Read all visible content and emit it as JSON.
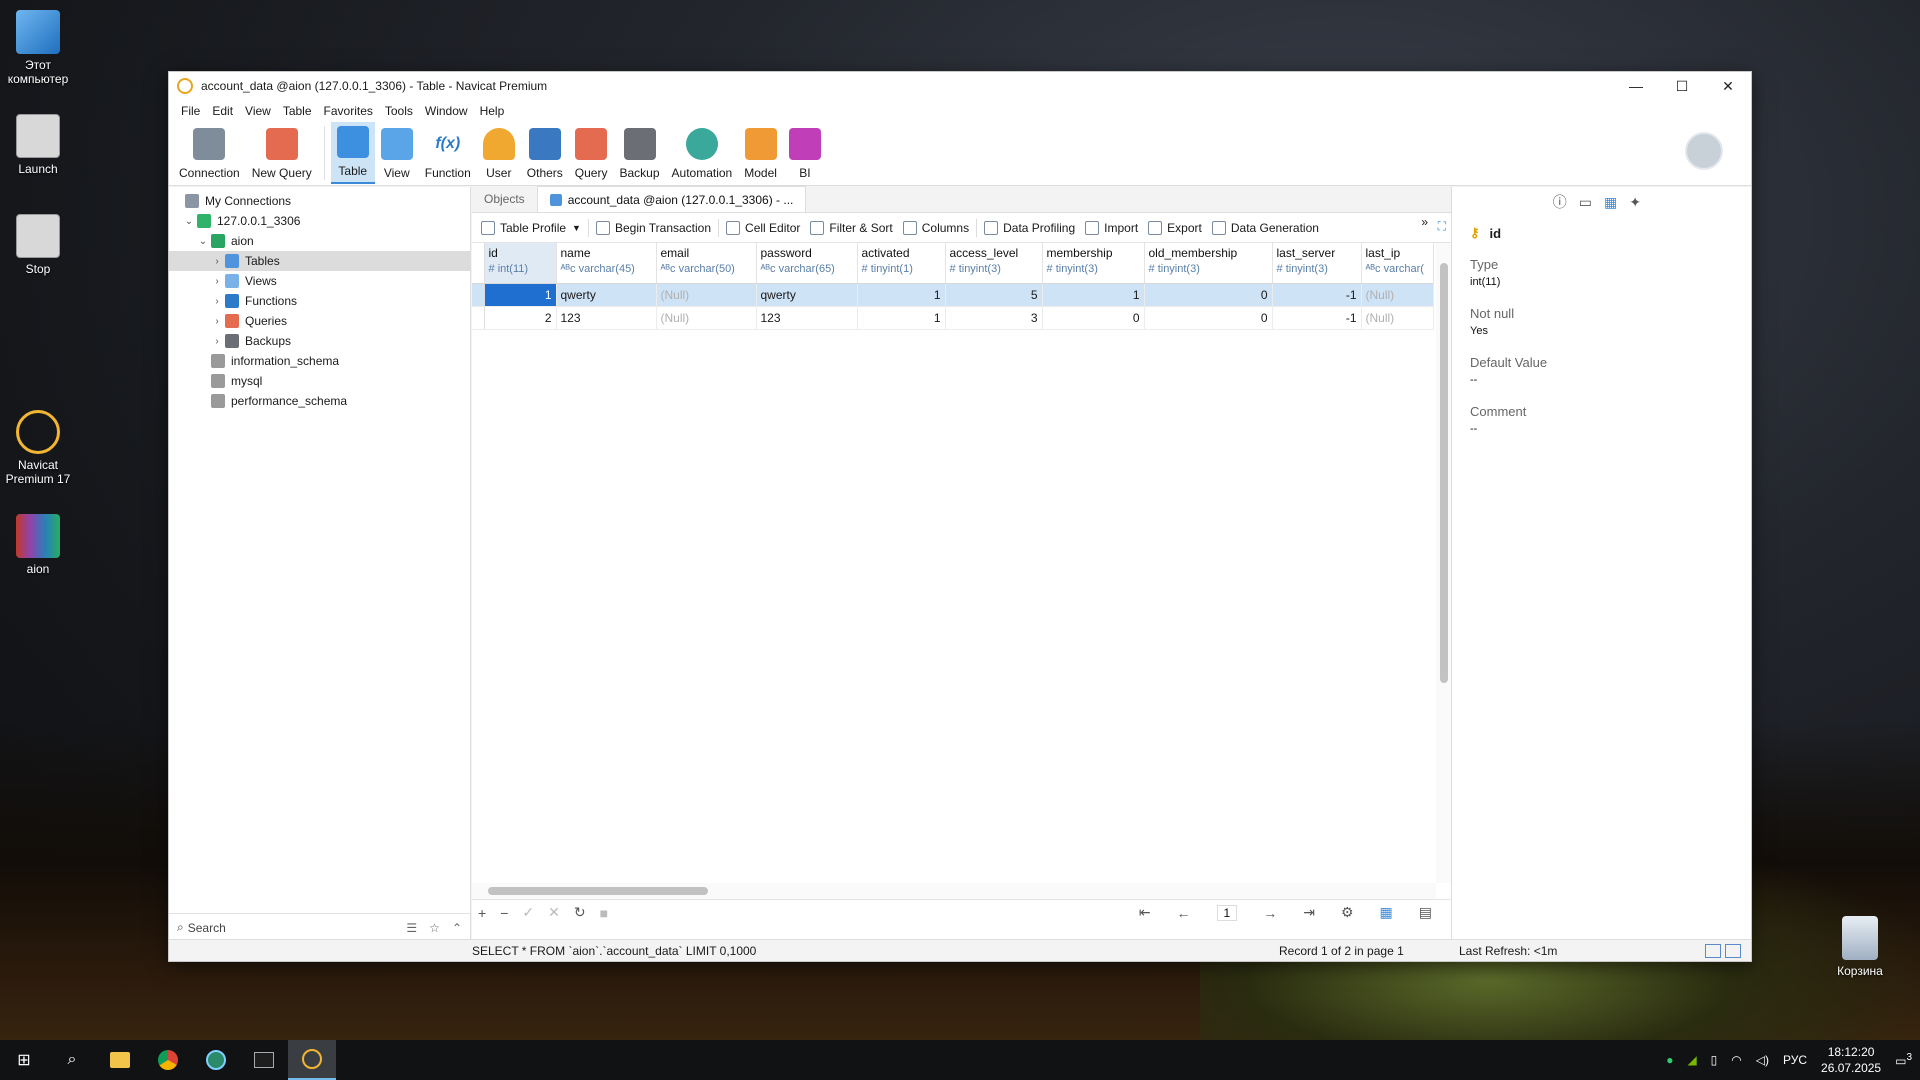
{
  "desktop": {
    "icons": [
      {
        "label": "Этот компьютер",
        "icon": "computer-icon"
      },
      {
        "label": "Launch",
        "icon": "gear-shortcut-icon"
      },
      {
        "label": "Stop",
        "icon": "gear-shortcut-icon"
      },
      {
        "label": "Navicat Premium 17",
        "icon": "navicat-icon"
      },
      {
        "label": "aion",
        "icon": "archive-icon"
      }
    ],
    "recycle_bin": "Корзина"
  },
  "window": {
    "title": "account_data @aion (127.0.0.1_3306) - Table - Navicat Premium",
    "controls": {
      "minimize": "—",
      "maximize": "☐",
      "close": "✕"
    }
  },
  "menu": [
    "File",
    "Edit",
    "View",
    "Table",
    "Favorites",
    "Tools",
    "Window",
    "Help"
  ],
  "toolbar": {
    "connection": "Connection",
    "new_query": "New Query",
    "table": "Table",
    "view": "View",
    "function": "Function",
    "user": "User",
    "others": "Others",
    "query": "Query",
    "backup": "Backup",
    "automation": "Automation",
    "model": "Model",
    "bi": "BI"
  },
  "sidebar": {
    "root": "My Connections",
    "connection": "127.0.0.1_3306",
    "database": "aion",
    "children": [
      "Tables",
      "Views",
      "Functions",
      "Queries",
      "Backups"
    ],
    "other_dbs": [
      "information_schema",
      "mysql",
      "performance_schema"
    ],
    "search_placeholder": "Search"
  },
  "tabs": {
    "objects": "Objects",
    "active": "account_data @aion (127.0.0.1_3306) - ..."
  },
  "data_toolbar": {
    "table_profile": "Table Profile",
    "begin_transaction": "Begin Transaction",
    "cell_editor": "Cell Editor",
    "filter_sort": "Filter & Sort",
    "columns": "Columns",
    "data_profiling": "Data Profiling",
    "import": "Import",
    "export": "Export",
    "data_generation": "Data Generation"
  },
  "grid": {
    "columns": [
      {
        "name": "id",
        "type": "int(11)"
      },
      {
        "name": "name",
        "type": "varchar(45)"
      },
      {
        "name": "email",
        "type": "varchar(50)"
      },
      {
        "name": "password",
        "type": "varchar(65)"
      },
      {
        "name": "activated",
        "type": "tinyint(1)"
      },
      {
        "name": "access_level",
        "type": "tinyint(3)"
      },
      {
        "name": "membership",
        "type": "tinyint(3)"
      },
      {
        "name": "old_membership",
        "type": "tinyint(3)"
      },
      {
        "name": "last_server",
        "type": "tinyint(3)"
      },
      {
        "name": "last_ip",
        "type": "varchar("
      }
    ],
    "rows": [
      [
        "1",
        "qwerty",
        "(Null)",
        "qwerty",
        "1",
        "5",
        "1",
        "0",
        "-1",
        "(Null)"
      ],
      [
        "2",
        "123",
        "(Null)",
        "123",
        "1",
        "3",
        "0",
        "0",
        "-1",
        "(Null)"
      ]
    ],
    "page": "1"
  },
  "field_panel": {
    "field_name": "id",
    "type_label": "Type",
    "type_value": "int(11)",
    "notnull_label": "Not null",
    "notnull_value": "Yes",
    "default_label": "Default Value",
    "default_value": "--",
    "comment_label": "Comment",
    "comment_value": "--"
  },
  "status": {
    "sql": "SELECT * FROM `aion`.`account_data` LIMIT 0,1000",
    "record": "Record 1 of 2 in page 1",
    "refresh": "Last Refresh: <1m"
  },
  "taskbar": {
    "lang": "РУС",
    "time": "18:12:20",
    "date": "26.07.2025",
    "notifications": "3"
  }
}
